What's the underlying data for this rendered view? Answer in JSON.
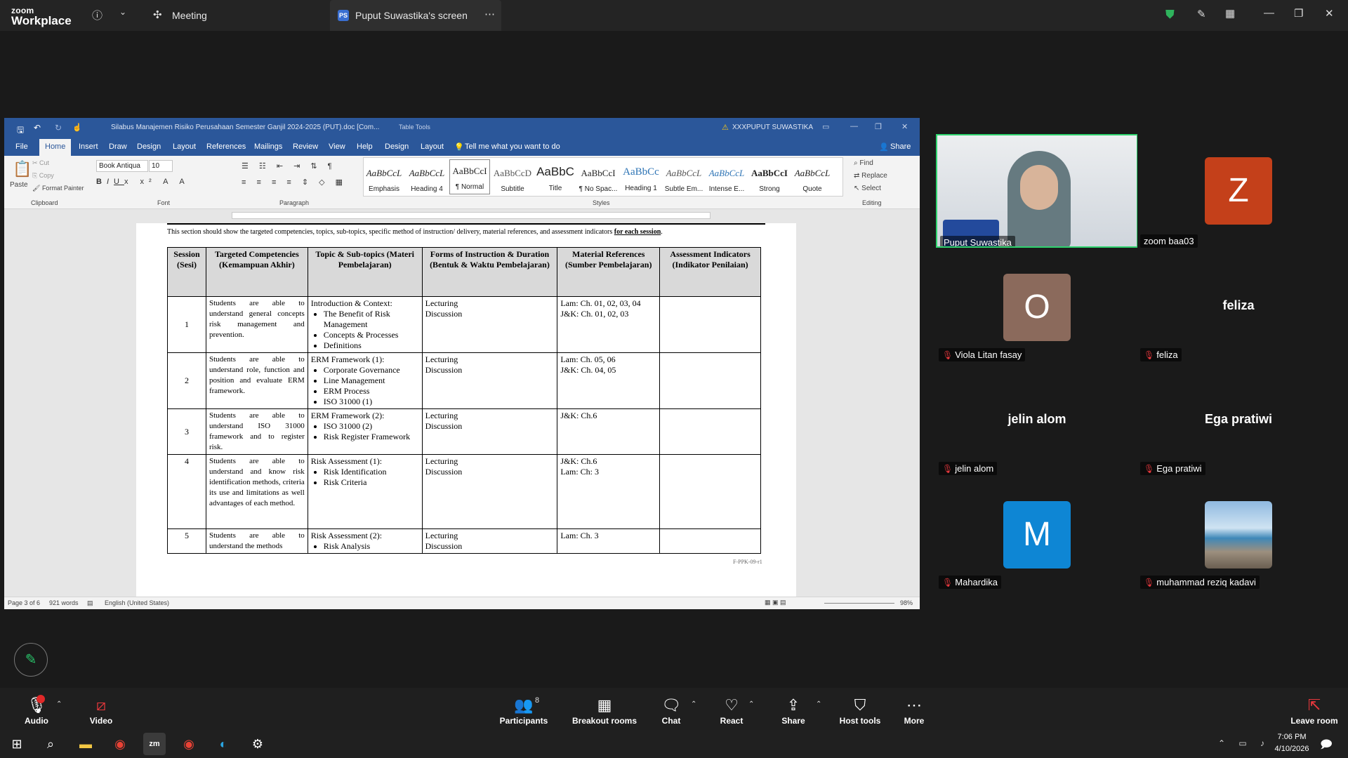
{
  "app": {
    "logo_line1": "zoom",
    "logo_line2": "Workplace",
    "meeting_label": "Meeting",
    "share_tab_badge": "PS",
    "share_tab_label": "Puput Suwastika's screen"
  },
  "word": {
    "doc_title": "Silabus Manajemen Risiko Perusahaan Semester Ganjil 2024-2025 (PUT).doc [Com...",
    "table_tools": "Table Tools",
    "user_name": "XXXPUPUT SUWASTIKA",
    "share": "Share",
    "tell_me": "Tell me what you want to do",
    "tabs": [
      "File",
      "Home",
      "Insert",
      "Draw",
      "Design",
      "Layout",
      "References",
      "Mailings",
      "Review",
      "View",
      "Help",
      "Design",
      "Layout"
    ],
    "clipboard": {
      "paste": "Paste",
      "cut": "Cut",
      "copy": "Copy",
      "format_painter": "Format Painter",
      "group": "Clipboard"
    },
    "font": {
      "name": "Book Antiqua",
      "size": "10",
      "group": "Font"
    },
    "paragraph_group": "Paragraph",
    "styles_group": "Styles",
    "editing": {
      "find": "Find",
      "replace": "Replace",
      "select": "Select",
      "group": "Editing"
    },
    "styles": [
      {
        "preview": "AaBbCcL",
        "name": "Emphasis"
      },
      {
        "preview": "AaBbCcL",
        "name": "Heading 4"
      },
      {
        "preview": "AaBbCcI",
        "name": "¶ Normal"
      },
      {
        "preview": "AaBbCcD",
        "name": "Subtitle"
      },
      {
        "preview": "AaBbC",
        "name": "Title"
      },
      {
        "preview": "AaBbCcI",
        "name": "¶ No Spac..."
      },
      {
        "preview": "AaBbCc",
        "name": "Heading 1"
      },
      {
        "preview": "AaBbCcL",
        "name": "Subtle Em..."
      },
      {
        "preview": "AaBbCcL",
        "name": "Intense E..."
      },
      {
        "preview": "AaBbCcI",
        "name": "Strong"
      },
      {
        "preview": "AaBbCcL",
        "name": "Quote"
      }
    ],
    "intro_text": "This section should show the targeted competencies, topics, sub-topics, specific method of instruction/ delivery, material references, and assessment indicators",
    "intro_emph": "for each session",
    "headers": [
      "Session (Sesi)",
      "Targeted Competencies (Kemampuan Akhir)",
      "Topic & Sub-topics (Materi Pembelajaran)",
      "Forms of Instruction & Duration (Bentuk & Waktu Pembelajaran)",
      "Material References (Sumber Pembelajaran)",
      "Assessment Indicators (Indikator Penilaian)"
    ],
    "rows": [
      {
        "session": "1",
        "competency": "Students are able to understand general concepts risk management and prevention.",
        "topic_title": "Introduction & Context:",
        "bullets": [
          "The Benefit of Risk Management",
          "Concepts & Processes",
          "Definitions"
        ],
        "forms": [
          "Lecturing",
          "Discussion"
        ],
        "refs": [
          "Lam: Ch. 01, 02, 03, 04",
          "J&K: Ch. 01, 02, 03"
        ]
      },
      {
        "session": "2",
        "competency": "Students are able to understand role, function and position and evaluate ERM framework.",
        "topic_title": "ERM Framework (1):",
        "bullets": [
          "Corporate Governance",
          "Line Management",
          "ERM Process",
          "ISO 31000 (1)"
        ],
        "forms": [
          "Lecturing",
          "Discussion"
        ],
        "refs": [
          "Lam: Ch. 05, 06",
          "J&K: Ch. 04, 05"
        ]
      },
      {
        "session": "3",
        "competency": "Students are able to understand ISO 31000 framework and to register risk.",
        "topic_title": "ERM Framework (2):",
        "bullets": [
          "ISO 31000 (2)",
          "Risk Register Framework"
        ],
        "forms": [
          "Lecturing",
          "Discussion"
        ],
        "refs": [
          "J&K: Ch.6"
        ]
      },
      {
        "session": "4",
        "competency": "Students are able to understand and know risk identification methods, criteria its use and limitations as well advantages of each method.",
        "topic_title": "Risk Assessment (1):",
        "bullets": [
          "Risk Identification",
          "Risk Criteria"
        ],
        "forms": [
          "Lecturing",
          "Discussion"
        ],
        "refs": [
          "J&K: Ch.6",
          "Lam: Ch: 3"
        ]
      },
      {
        "session": "5",
        "competency": "Students are able to understand the methods",
        "topic_title": "Risk Assessment (2):",
        "bullets": [
          "Risk Analysis"
        ],
        "forms": [
          "Lecturing",
          "Discussion"
        ],
        "refs": [
          "Lam: Ch. 3"
        ]
      }
    ],
    "footer_code": "F-PPK-09-r1",
    "status": {
      "page": "Page 3 of 6",
      "words": "921 words",
      "language": "English (United States)",
      "zoom": "98%"
    }
  },
  "participants": [
    {
      "name": "Puput Suwastika",
      "type": "video"
    },
    {
      "name": "zoom baa03",
      "type": "avatar",
      "initial": "Z",
      "color": "#c4401a"
    },
    {
      "name": "Viola Litan fasay",
      "type": "avatar",
      "initial": "O",
      "color": "#8b6a5c",
      "muted": true
    },
    {
      "name": "feliza",
      "type": "text",
      "display": "feliza",
      "muted": true
    },
    {
      "name": "jelin alom",
      "type": "text",
      "display": "jelin alom",
      "muted": true
    },
    {
      "name": "Ega pratiwi",
      "type": "text",
      "display": "Ega pratiwi",
      "muted": true
    },
    {
      "name": "Mahardika",
      "type": "avatar",
      "initial": "M",
      "color": "#0e86d4",
      "muted": true
    },
    {
      "name": "muhammad reziq kadavi",
      "type": "photo",
      "muted": true
    }
  ],
  "toolbar": {
    "audio": "Audio",
    "video": "Video",
    "participants": "Participants",
    "participants_count": "8",
    "breakout": "Breakout rooms",
    "chat": "Chat",
    "react": "React",
    "share": "Share",
    "host_tools": "Host tools",
    "more": "More",
    "leave": "Leave room"
  },
  "taskbar": {
    "time": "7:06 PM",
    "date": "4/10/2026"
  }
}
